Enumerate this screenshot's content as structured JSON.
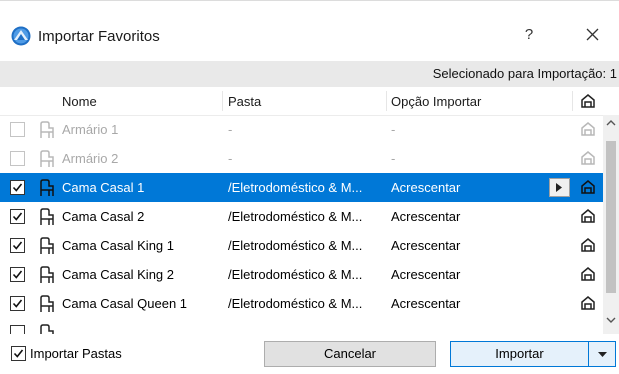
{
  "window": {
    "title": "Importar Favoritos",
    "help_label": "?",
    "app_icon": "archicad-icon",
    "close_icon": "close-icon"
  },
  "selection_bar": {
    "text": "Selecionado para Importação: 1"
  },
  "table": {
    "columns": {
      "name": "Nome",
      "folder": "Pasta",
      "option": "Opção Importar",
      "house_icon": "house-icon"
    },
    "rows": [
      {
        "checked": false,
        "disabled": true,
        "selected": false,
        "name": "Armário 1",
        "folder": "-",
        "option": "-"
      },
      {
        "checked": false,
        "disabled": true,
        "selected": false,
        "name": "Armário 2",
        "folder": "-",
        "option": "-"
      },
      {
        "checked": true,
        "disabled": false,
        "selected": true,
        "name": "Cama Casal 1",
        "folder": "/Eletrodoméstico & M...",
        "option": "Acrescentar"
      },
      {
        "checked": true,
        "disabled": false,
        "selected": false,
        "name": "Cama Casal 2",
        "folder": "/Eletrodoméstico & M...",
        "option": "Acrescentar"
      },
      {
        "checked": true,
        "disabled": false,
        "selected": false,
        "name": "Cama Casal King 1",
        "folder": "/Eletrodoméstico & M...",
        "option": "Acrescentar"
      },
      {
        "checked": true,
        "disabled": false,
        "selected": false,
        "name": "Cama Casal King 2",
        "folder": "/Eletrodoméstico & M...",
        "option": "Acrescentar"
      },
      {
        "checked": true,
        "disabled": false,
        "selected": false,
        "name": "Cama Casal Queen 1",
        "folder": "/Eletrodoméstico & M...",
        "option": "Acrescentar"
      },
      {
        "checked": false,
        "disabled": false,
        "selected": false,
        "name": "",
        "folder": "",
        "option": ""
      }
    ]
  },
  "footer": {
    "import_folders_label": "Importar Pastas",
    "import_folders_checked": true,
    "cancel_label": "Cancelar",
    "import_label": "Importar"
  },
  "colors": {
    "selection": "#0078d7",
    "header_bar": "#e9e9e9",
    "disabled_text": "#a8a8a8"
  }
}
